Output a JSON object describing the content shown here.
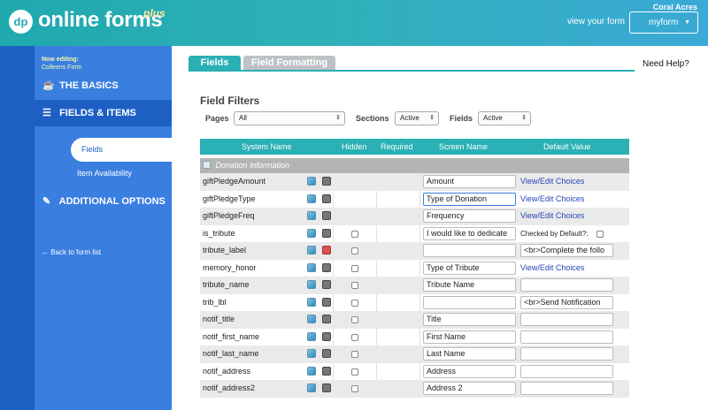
{
  "header": {
    "logo_mark": "dp",
    "logo_text": "online forms",
    "logo_plus": "plus",
    "account_name": "Coral Acres",
    "view_form_label": "view your form",
    "form_select_value": "myform"
  },
  "sidebar": {
    "now_editing_label": "Now editing:",
    "now_editing_form": "Colleens Form",
    "basics_label": "THE BASICS",
    "fields_items_label": "FIELDS & ITEMS",
    "sub_fields_label": "Fields",
    "sub_item_availability_label": "Item Availability",
    "additional_options_label": "ADDITIONAL OPTIONS",
    "back_label": "Back to form list"
  },
  "tabs": {
    "fields_label": "Fields",
    "formatting_label": "Field Formatting"
  },
  "need_help_label": "Need Help?",
  "filters": {
    "title": "Field Filters",
    "pages_label": "Pages",
    "pages_value": "All",
    "sections_label": "Sections",
    "sections_value": "Active",
    "fields_label": "Fields",
    "fields_value": "Active"
  },
  "table": {
    "columns": {
      "system_name": "System Name",
      "hidden": "Hidden",
      "required": "Required",
      "screen_name": "Screen Name",
      "default_value": "Default Value"
    },
    "section_name": "Donation Information",
    "view_edit_label": "View/Edit Choices",
    "checked_default_label": "Checked by Default?:",
    "rows": [
      {
        "system_name": "giftPledgeAmount",
        "screen_name": "Amount",
        "default_value": ""
      },
      {
        "system_name": "giftPledgeType",
        "screen_name": "Type of Donation",
        "default_value": ""
      },
      {
        "system_name": "giftPledgeFreq",
        "screen_name": "Frequency",
        "default_value": ""
      },
      {
        "system_name": "is_tribute",
        "screen_name": "I would like to dedicate",
        "default_value": ""
      },
      {
        "system_name": "tribute_label",
        "screen_name": "",
        "default_value": "<br>Complete the follo"
      },
      {
        "system_name": "memory_honor",
        "screen_name": "Type of Tribute",
        "default_value": ""
      },
      {
        "system_name": "tribute_name",
        "screen_name": "Tribute Name",
        "default_value": ""
      },
      {
        "system_name": "trib_lbl",
        "screen_name": "",
        "default_value": "<br>Send Notification"
      },
      {
        "system_name": "notif_title",
        "screen_name": "Title",
        "default_value": ""
      },
      {
        "system_name": "notif_first_name",
        "screen_name": "First Name",
        "default_value": ""
      },
      {
        "system_name": "notif_last_name",
        "screen_name": "Last Name",
        "default_value": ""
      },
      {
        "system_name": "notif_address",
        "screen_name": "Address",
        "default_value": ""
      },
      {
        "system_name": "notif_address2",
        "screen_name": "Address 2",
        "default_value": ""
      }
    ]
  }
}
